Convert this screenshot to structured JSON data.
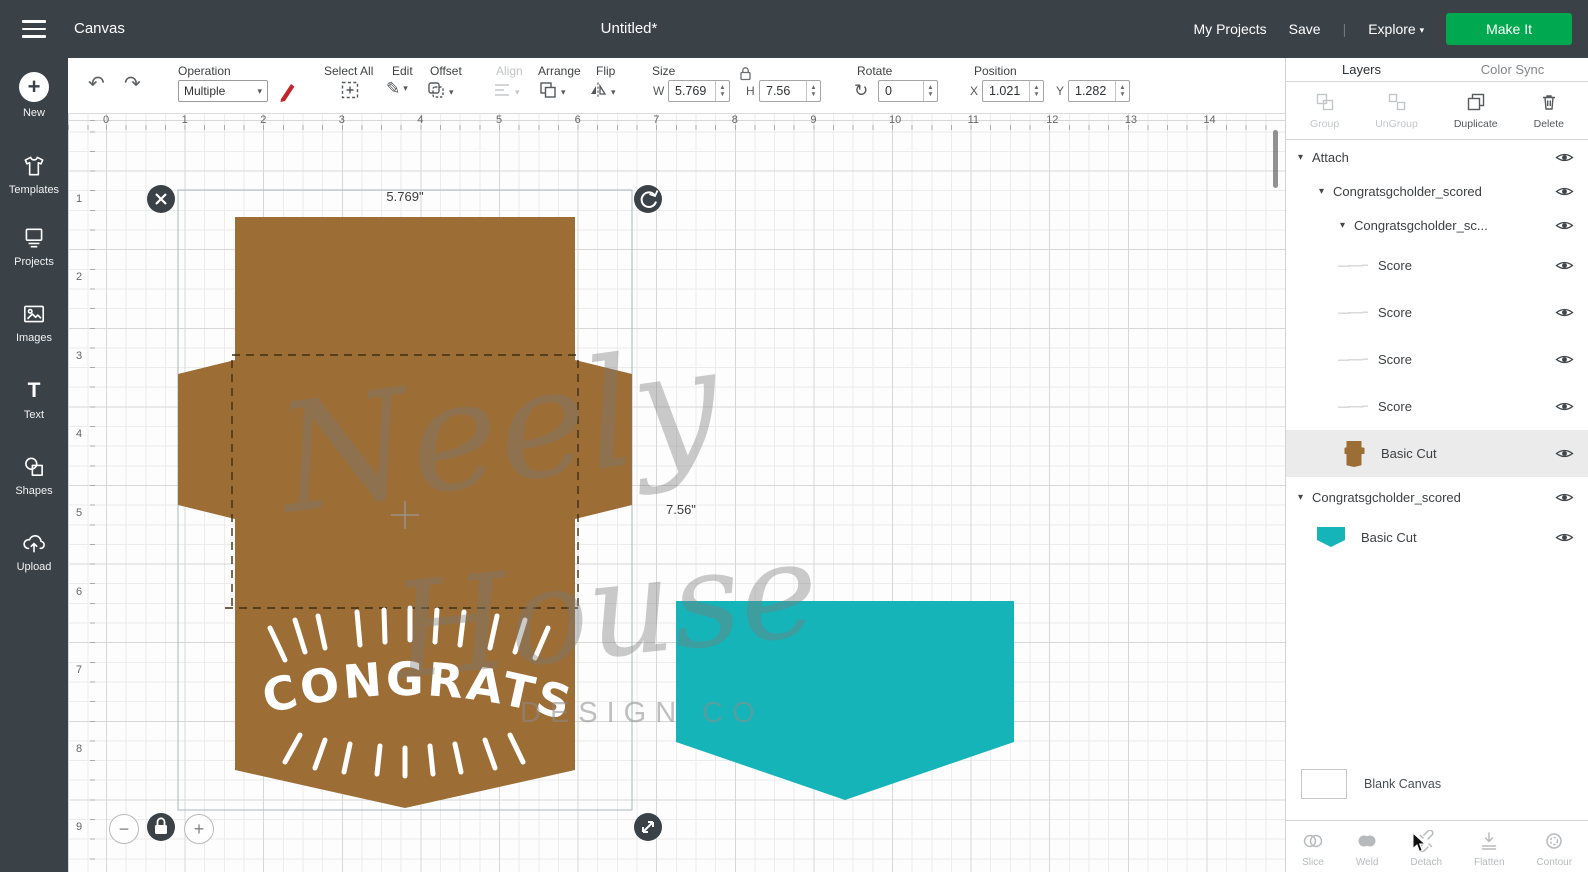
{
  "topbar": {
    "canvas": "Canvas",
    "title": "Untitled*",
    "my_projects": "My Projects",
    "save": "Save",
    "divider": "|",
    "explore": "Explore",
    "make_it": "Make It"
  },
  "toolbar": {
    "operation_label": "Operation",
    "operation_value": "Multiple",
    "select_all": "Select All",
    "edit": "Edit",
    "offset": "Offset",
    "align": "Align",
    "arrange": "Arrange",
    "flip": "Flip",
    "size_label": "Size",
    "w_label": "W",
    "w_value": "5.769",
    "h_label": "H",
    "h_value": "7.56",
    "rotate_label": "Rotate",
    "rotate_value": "0",
    "position_label": "Position",
    "x_label": "X",
    "x_value": "1.021",
    "y_label": "Y",
    "y_value": "1.282"
  },
  "sidebar": {
    "items": [
      {
        "label": "New"
      },
      {
        "label": "Templates"
      },
      {
        "label": "Projects"
      },
      {
        "label": "Images"
      },
      {
        "label": "Text"
      },
      {
        "label": "Shapes"
      },
      {
        "label": "Upload"
      }
    ]
  },
  "canvas": {
    "ruler_h": [
      "0",
      "1",
      "2",
      "3",
      "4",
      "5",
      "6",
      "7",
      "8",
      "9",
      "10",
      "11",
      "12",
      "13",
      "14"
    ],
    "ruler_v": [
      "1",
      "2",
      "3",
      "4",
      "5",
      "6",
      "7",
      "8",
      "9"
    ],
    "selection_width": "5.769\"",
    "selection_height": "7.56\"",
    "congrats": "CONGRATS",
    "watermark": {
      "line1": "Neely",
      "line2": "House",
      "line3": "DESIGN CO"
    },
    "zoom_out": "−",
    "zoom_in": "+"
  },
  "layers_panel": {
    "tabs": {
      "layers": "Layers",
      "color_sync": "Color Sync"
    },
    "actions": [
      {
        "label": "Group"
      },
      {
        "label": "UnGroup"
      },
      {
        "label": "Duplicate"
      },
      {
        "label": "Delete"
      }
    ],
    "rows": [
      {
        "label": "Attach"
      },
      {
        "label": "Congratsgcholder_scored"
      },
      {
        "label": "Congratsgcholder_sc..."
      },
      {
        "label": "Score"
      },
      {
        "label": "Score"
      },
      {
        "label": "Score"
      },
      {
        "label": "Score"
      },
      {
        "label": "Basic Cut"
      },
      {
        "label": "Congratsgcholder_scored"
      },
      {
        "label": "Basic Cut"
      }
    ],
    "blank_canvas": "Blank Canvas",
    "bottom_actions": [
      {
        "label": "Slice"
      },
      {
        "label": "Weld"
      },
      {
        "label": "Detach"
      },
      {
        "label": "Flatten"
      },
      {
        "label": "Contour"
      }
    ]
  },
  "colors": {
    "chrome_dark": "#3A4147",
    "accent_green": "#00A94F",
    "brown": "#9C6D35",
    "teal": "#15B4B8",
    "score_red": "#C0272D"
  }
}
